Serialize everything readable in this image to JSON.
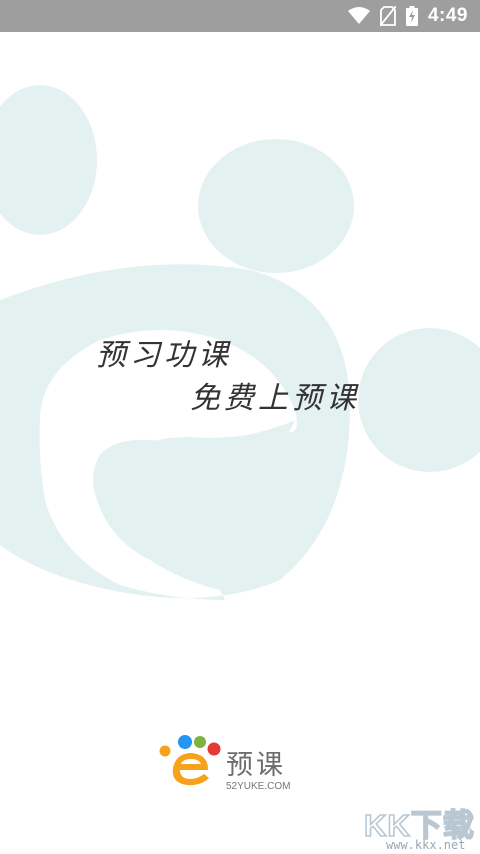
{
  "status_bar": {
    "time": "4:49",
    "icons": [
      "wifi-icon",
      "no-sim-icon",
      "battery-charging-icon"
    ]
  },
  "splash": {
    "slogan_line1": "预习功课",
    "slogan_line2": "免费上预课"
  },
  "brand": {
    "name": "预课",
    "domain": "52YUKE.COM",
    "colors": {
      "blue": "#2196F3",
      "green": "#7CB342",
      "red": "#E53935",
      "orange": "#F7A21B"
    }
  },
  "watermark": {
    "big": "KK下载",
    "small": "www.kkx.net"
  },
  "colors": {
    "status_bar": "#9E9E9E",
    "background": "#FFFFFF",
    "art_shape": "#E4F1F1"
  }
}
